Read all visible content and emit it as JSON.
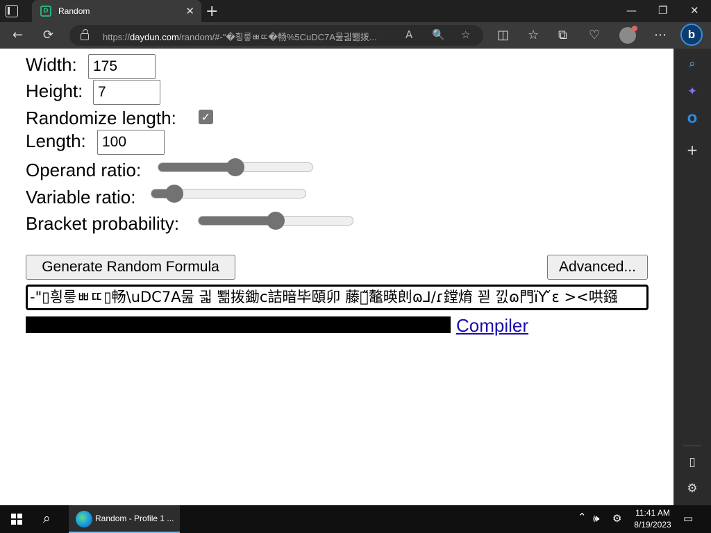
{
  "browser": {
    "tab_title": "Random",
    "tab_favicon": "D",
    "tab_close": "✕",
    "new_tab": "+",
    "window_controls": {
      "minimize": "—",
      "restore": "❐",
      "close": "✕"
    },
    "nav": {
      "back": "←",
      "refresh": "⟳"
    },
    "url_prefix": "https://",
    "url_host": "daydun.com",
    "url_path": "/random/#-\"�힁릏ㅃㄸ�畅%5CuDC7A뭂긟뾂拨...",
    "url_icons": {
      "read_aloud": "A",
      "zoom": "🔍",
      "favorite": "☆"
    },
    "toolbar_icons": {
      "split_screen": "◫",
      "favorites": "☆",
      "collections": "⧉",
      "performance": "♡",
      "more": "⋯"
    },
    "bing_label": "b"
  },
  "form": {
    "width_label": "Width:",
    "width_value": "175",
    "height_label": "Height:",
    "height_value": "7",
    "randomize_label": "Randomize length:",
    "randomize_checked": true,
    "length_label": "Length:",
    "length_value": "100",
    "operand_label": "Operand ratio:",
    "operand_ratio": 0.5,
    "variable_label": "Variable ratio:",
    "variable_ratio": 0.15,
    "bracket_label": "Bracket probability:",
    "bracket_probability": 0.5,
    "generate_button": "Generate Random Formula",
    "advanced_button": "Advanced...",
    "formula_text": "-\"▯힁릏ㅃㄸ▯畅\\uDC7A뭂 긟 뾂拨鋤c詰暗毕頤卯 藤俥̋鼇暎剆ɷ⅃/ɾ鏜焴 꾇 낈ɷ門ïY ̌ɛ ><哄鏹",
    "compiler_link": "Compiler"
  },
  "sidebar": {
    "search": "⌕",
    "copilot": "✦",
    "outlook": "O",
    "add": "+",
    "hide": "▯",
    "settings": "⚙"
  },
  "taskbar": {
    "search_icon": "⌕",
    "edge_label": "Random - Profile 1 ...",
    "tray_up": "⌃",
    "volume": "🕪",
    "settings": "⚙",
    "notifications": "▭",
    "time": "11:41 AM",
    "date": "8/19/2023"
  },
  "colors": {
    "accent": "#1a0dab",
    "slider_fill": "#727272",
    "edge_blue": "#3b8de0"
  }
}
